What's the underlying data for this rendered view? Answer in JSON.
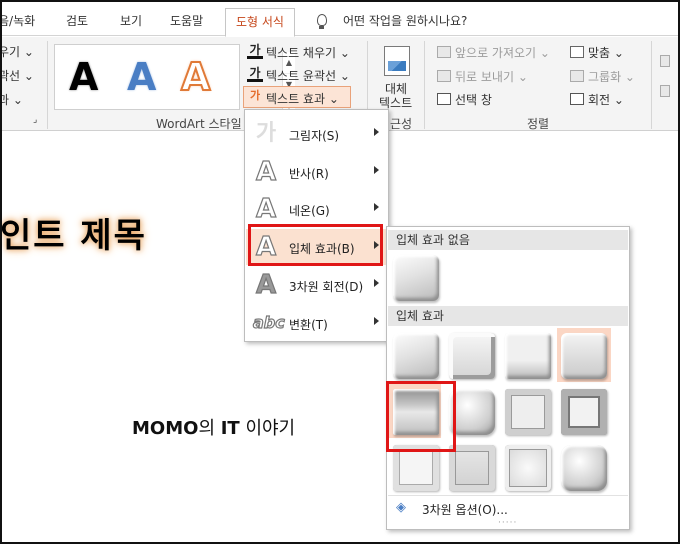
{
  "tabs": [
    {
      "label": "음/녹화"
    },
    {
      "label": "검토"
    },
    {
      "label": "보기"
    },
    {
      "label": "도움말"
    },
    {
      "label": "도형 서식"
    }
  ],
  "tell_me": {
    "placeholder": "어떤 작업을 원하시나요?"
  },
  "ribbon": {
    "left_items": [
      "우기 ⌄",
      "곽선 ⌄",
      "과 ⌄"
    ],
    "wordart_label": "WordArt 스타일",
    "wordart_samples": [
      "A",
      "A",
      "A"
    ],
    "text_fill": "텍스트 채우기 ⌄",
    "text_outline": "텍스트 윤곽선 ⌄",
    "text_effects": "텍스트 효과 ⌄",
    "ga_glyph": "가",
    "alt_text": {
      "line1": "대체",
      "line2": "텍스트"
    },
    "access_label": "근성",
    "bring_forward": "앞으로 가져오기 ⌄",
    "send_backward": "뒤로 보내기 ⌄",
    "selection_pane": "선택 창",
    "align": "맞춤 ⌄",
    "group": "그룹화 ⌄",
    "rotate": "회전 ⌄",
    "arrange_label": "정렬"
  },
  "document": {
    "title": "인트 제목",
    "subtitle_a": "MOMO",
    "subtitle_b": "의 ",
    "subtitle_c": "IT",
    "subtitle_d": " 이야기"
  },
  "menu": {
    "items": [
      {
        "glyph": "가",
        "label": "그림자(S)"
      },
      {
        "glyph": "A",
        "label": "반사(R)"
      },
      {
        "glyph": "A",
        "label": "네온(G)"
      },
      {
        "glyph": "A",
        "label": "입체 효과(B)"
      },
      {
        "glyph": "A",
        "label": "3차원 회전(D)"
      },
      {
        "glyph": "abc",
        "label": "변환(T)"
      }
    ]
  },
  "gallery": {
    "none_header": "입체 효과 없음",
    "bevel_header": "입체 효과",
    "options": "3차원 옵션(O)..."
  },
  "colors": {
    "accent": "#c6471b",
    "highlight": "#fbe1d0",
    "callout": "#e01616"
  }
}
